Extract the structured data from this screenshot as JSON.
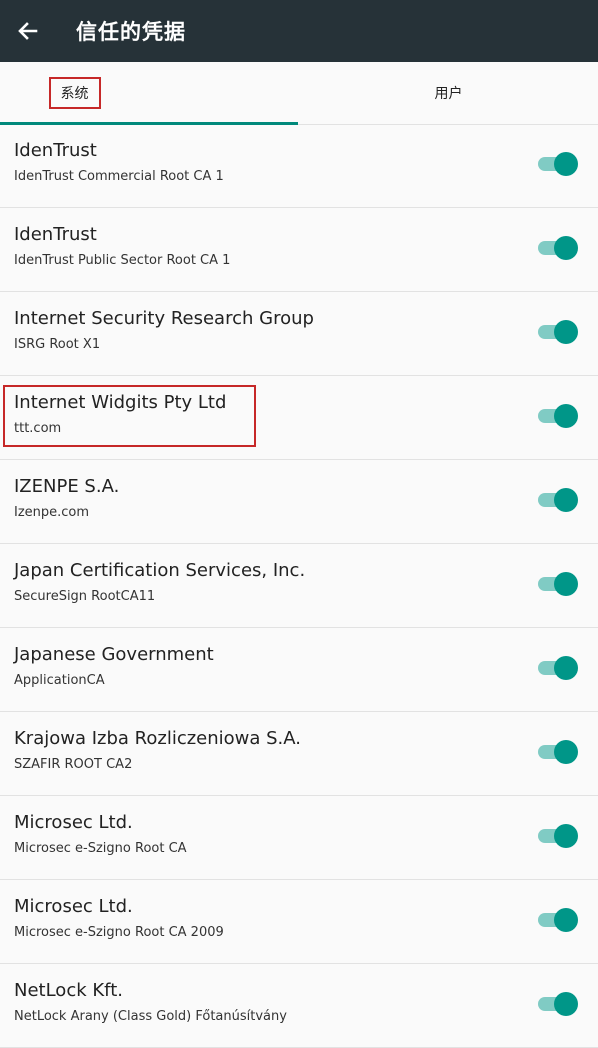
{
  "appbar": {
    "title": "信任的凭据"
  },
  "tabs": [
    {
      "label": "系统",
      "active": true
    },
    {
      "label": "用户",
      "active": false
    }
  ],
  "colors": {
    "appbar": "#263238",
    "accent": "#009688",
    "track": "#80cbc4",
    "highlight": "#c62828"
  },
  "certs": [
    {
      "title": "IdenTrust",
      "sub": "IdenTrust Commercial Root CA 1",
      "enabled": true
    },
    {
      "title": "IdenTrust",
      "sub": "IdenTrust Public Sector Root CA 1",
      "enabled": true
    },
    {
      "title": "Internet Security Research Group",
      "sub": "ISRG Root X1",
      "enabled": true
    },
    {
      "title": "Internet Widgits Pty Ltd",
      "sub": "ttt.com",
      "enabled": true
    },
    {
      "title": "IZENPE S.A.",
      "sub": "Izenpe.com",
      "enabled": true
    },
    {
      "title": "Japan Certification Services, Inc.",
      "sub": "SecureSign RootCA11",
      "enabled": true
    },
    {
      "title": "Japanese Government",
      "sub": "ApplicationCA",
      "enabled": true
    },
    {
      "title": "Krajowa Izba Rozliczeniowa S.A.",
      "sub": "SZAFIR ROOT CA2",
      "enabled": true
    },
    {
      "title": "Microsec Ltd.",
      "sub": "Microsec e-Szigno Root CA",
      "enabled": true
    },
    {
      "title": "Microsec Ltd.",
      "sub": "Microsec e-Szigno Root CA 2009",
      "enabled": true
    },
    {
      "title": "NetLock Kft.",
      "sub": "NetLock Arany (Class Gold) Főtanúsítvány",
      "enabled": true
    }
  ]
}
